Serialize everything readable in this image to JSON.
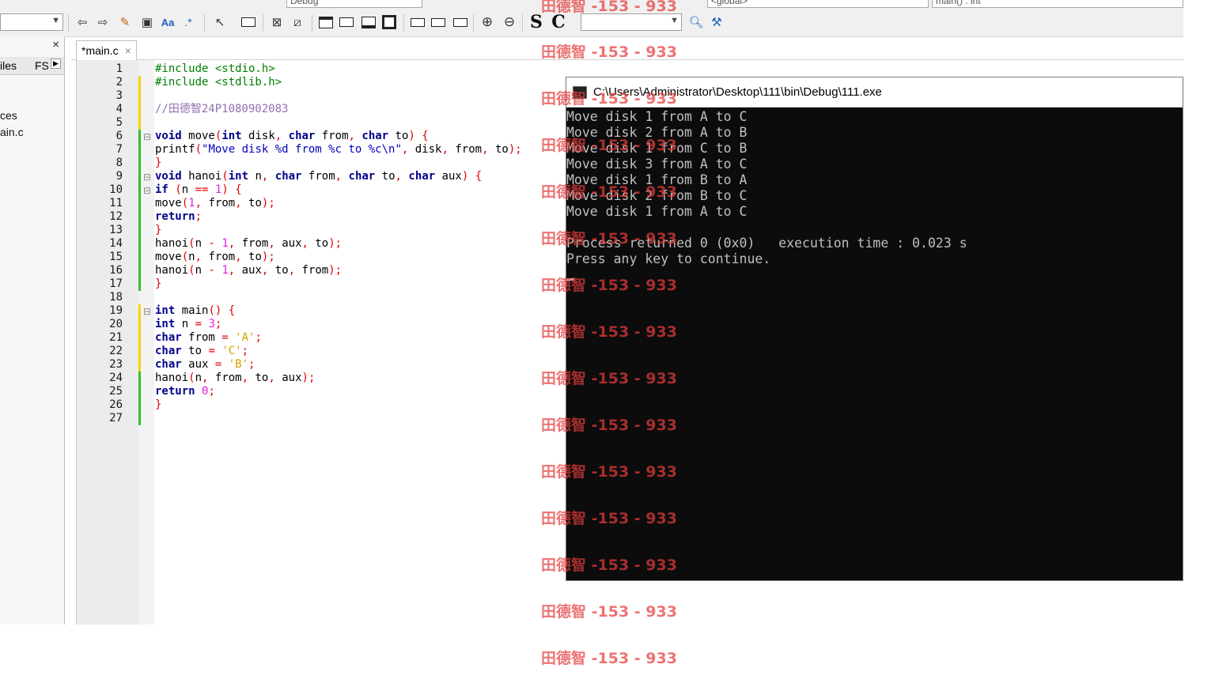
{
  "toolbar": {
    "build_target": "Debug",
    "scope_combo": "<global>",
    "function_combo": "main() : int",
    "search_value": "",
    "S_label": "S",
    "C_label": "C",
    "regex_label": ".*",
    "font_label": "Aa"
  },
  "left_panel": {
    "close": "×",
    "tab_files": "iles",
    "tab_fs": "FS",
    "tree_items": [
      "ces",
      "ain.c"
    ]
  },
  "editor": {
    "tab_label": "*main.c",
    "tab_close": "×",
    "line_numbers": [
      "1",
      "2",
      "3",
      "4",
      "5",
      "6",
      "7",
      "8",
      "9",
      "10",
      "11",
      "12",
      "13",
      "14",
      "15",
      "16",
      "17",
      "18",
      "19",
      "20",
      "21",
      "22",
      "23",
      "24",
      "25",
      "26",
      "27"
    ]
  },
  "console": {
    "title": "C:\\Users\\Administrator\\Desktop\\111\\bin\\Debug\\111.exe",
    "lines": [
      "Move disk 1 from A to C",
      "Move disk 2 from A to B",
      "Move disk 1 from C to B",
      "Move disk 3 from A to C",
      "Move disk 1 from B to A",
      "Move disk 2 from B to C",
      "Move disk 1 from A to C",
      "",
      "Process returned 0 (0x0)   execution time : 0.023 s",
      "Press any key to continue."
    ]
  },
  "watermark": "田德智 -153 - 933",
  "colors": {
    "keyword": "#00008b",
    "preprocessor": "#008000",
    "comment": "#9070b0",
    "char_literal": "#d4a000",
    "number": "#e020e0",
    "operator": "#e00000",
    "string": "#0000c0",
    "console_bg": "#0c0c0c",
    "console_fg": "#c0c0c0",
    "watermark": "#e63c3c"
  }
}
